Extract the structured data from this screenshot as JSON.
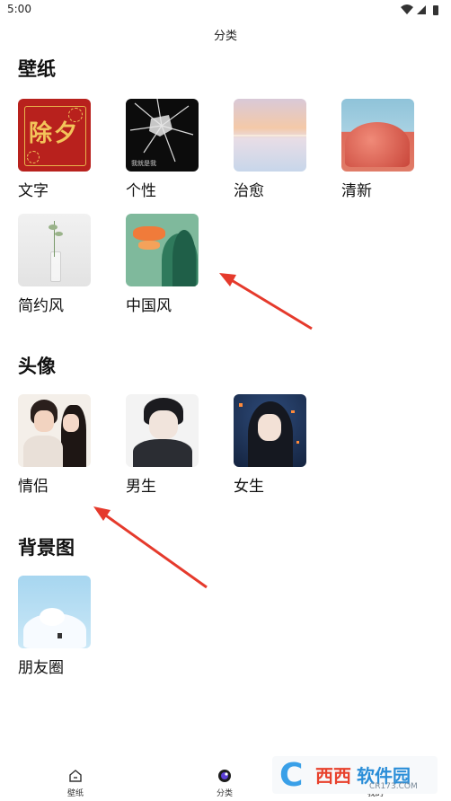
{
  "status_bar": {
    "time": "5:00"
  },
  "header": {
    "title": "分类"
  },
  "sections": [
    {
      "title": "壁纸",
      "items": [
        {
          "label": "文字"
        },
        {
          "label": "个性"
        },
        {
          "label": "治愈"
        },
        {
          "label": "清新"
        },
        {
          "label": "简约风"
        },
        {
          "label": "中国风"
        }
      ]
    },
    {
      "title": "头像",
      "items": [
        {
          "label": "情侣"
        },
        {
          "label": "男生"
        },
        {
          "label": "女生"
        }
      ]
    },
    {
      "title": "背景图",
      "items": [
        {
          "label": "朋友圈"
        }
      ]
    }
  ],
  "thumb_text": {
    "chuxi": "除夕",
    "gexing_caption": "我就是我"
  },
  "bottom_nav": [
    {
      "label": "壁纸",
      "icon": "home-icon"
    },
    {
      "label": "分类",
      "icon": "category-icon",
      "active": true
    },
    {
      "label": "我的",
      "icon": "profile-icon"
    }
  ],
  "watermark": {
    "brand": "西西",
    "brand2": "软件园",
    "url": "CR173.COM"
  },
  "colors": {
    "arrow": "#e53a2c",
    "nav_active": "#5b3fd6"
  }
}
